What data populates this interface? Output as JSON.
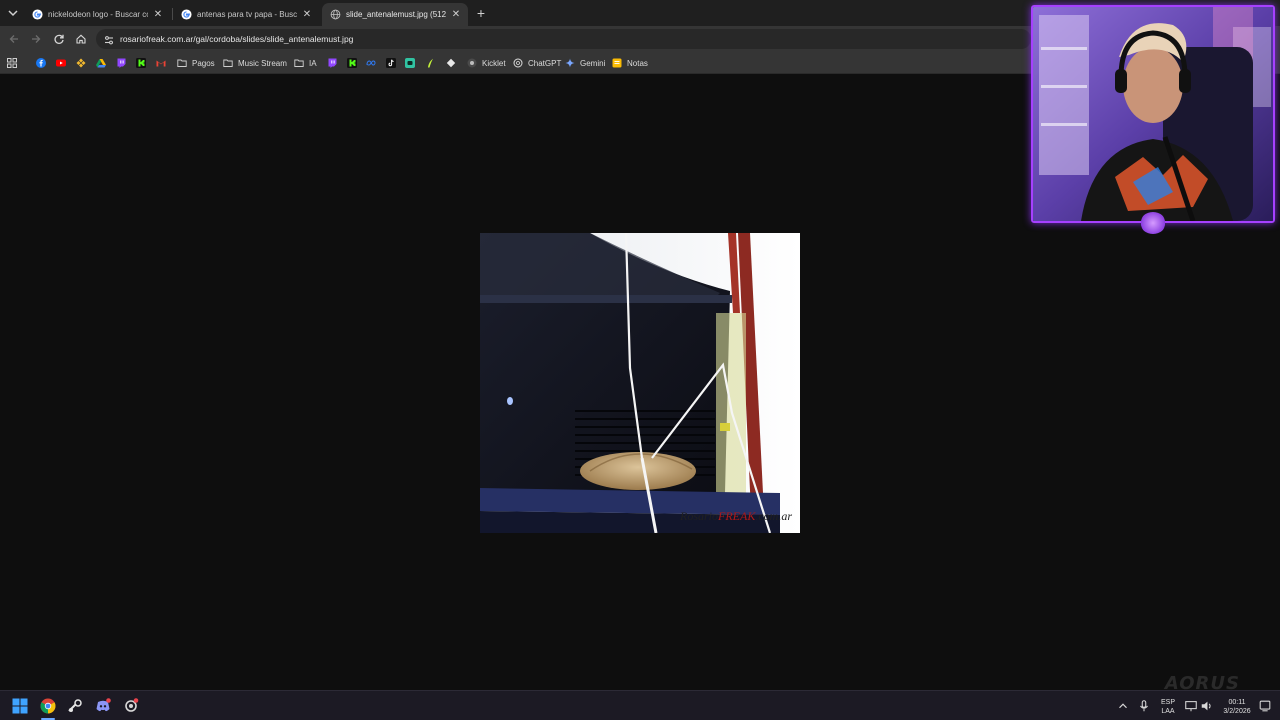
{
  "browser": {
    "tabs": [
      {
        "title": "nickelodeon logo - Buscar con",
        "active": false
      },
      {
        "title": "antenas para tv papa - Buscar c",
        "active": false
      },
      {
        "title": "slide_antenalemust.jpg (512×48",
        "active": true
      }
    ],
    "url": "rosariofreak.com.ar/gal/cordoba/slides/slide_antenalemust.jpg",
    "bookmarks": {
      "pagos": "Pagos",
      "music_stream": "Music Stream",
      "ia": "IA",
      "kicklet": "Kicklet",
      "chatgpt": "ChatGPT",
      "gemini": "Gemini",
      "notas": "Notas"
    }
  },
  "image": {
    "watermark_pre": "Rosario",
    "watermark_mid": "FREAK",
    "watermark_post": ".com.ar"
  },
  "overlay": {
    "brand": "AORUS"
  },
  "taskbar": {
    "lang_top": "ESP",
    "lang_bottom": "LAA",
    "time": "00:11",
    "date": "3/2/2026"
  },
  "colors": {
    "accent": "#a640ff",
    "tab_active_bg": "#353535",
    "page_bg": "#0e0e0e"
  }
}
